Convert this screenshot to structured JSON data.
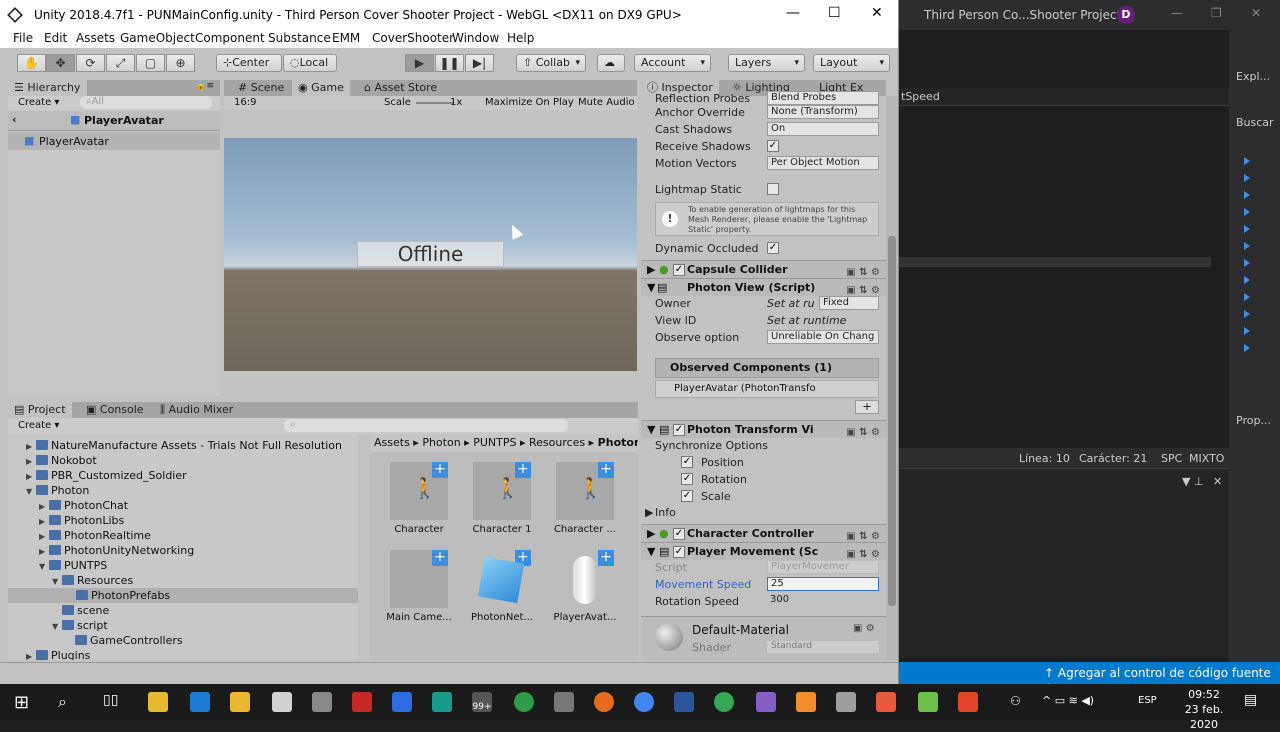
{
  "unity": {
    "title": "Unity 2018.4.7f1 - PUNMainConfig.unity - Third Person Cover Shooter Project - WebGL <DX11 on DX9 GPU>",
    "menu": [
      "File",
      "Edit",
      "Assets",
      "GameObject",
      "Component",
      "Substance",
      "EMM",
      "CoverShooter",
      "Window",
      "Help"
    ],
    "toolbar": {
      "center": "Center",
      "local": "Local",
      "collab": "Collab",
      "account": "Account",
      "layers": "Layers",
      "layout": "Layout"
    },
    "hierarchy": {
      "tab": "Hierarchy",
      "create": "Create",
      "search": "All",
      "prefab": "PlayerAvatar",
      "row": "PlayerAvatar"
    },
    "scene_tabs": {
      "scene": "Scene",
      "game": "Game",
      "asset_store": "Asset Store"
    },
    "game": {
      "aspect": "16:9",
      "scale_label": "Scale",
      "scale_value": "1x",
      "maximize": "Maximize On Play",
      "mute": "Mute Audio",
      "offline": "Offline"
    },
    "project": {
      "tabs": {
        "project": "Project",
        "console": "Console",
        "audio": "Audio Mixer"
      },
      "create": "Create",
      "tree": [
        "NatureManufacture Assets - Trials Not Full Resolution",
        "Nokobot",
        "PBR_Customized_Soldier",
        "Photon",
        "PhotonChat",
        "PhotonLibs",
        "PhotonRealtime",
        "PhotonUnityNetworking",
        "PUNTPS",
        "Resources",
        "PhotonPrefabs",
        "scene",
        "script",
        "GameControllers",
        "Plugins"
      ],
      "breadcrumb": [
        "Assets",
        "Photon",
        "PUNTPS",
        "Resources",
        "PhotonPrefabs"
      ],
      "assets": [
        "Character",
        "Character 1",
        "Character ...",
        "Main Came...",
        "PhotonNet...",
        "PlayerAvat..."
      ]
    },
    "inspector": {
      "tabs": {
        "inspector": "Inspector",
        "lighting": "Lighting",
        "light": "Light Ex"
      },
      "rows": [
        {
          "k": "Reflection Probes",
          "v": "Blend Probes"
        },
        {
          "k": "Anchor Override",
          "v": "None (Transform)"
        },
        {
          "k": "Cast Shadows",
          "v": "On"
        },
        {
          "k": "Receive Shadows",
          "v": "✓"
        },
        {
          "k": "Motion Vectors",
          "v": "Per Object Motion"
        },
        {
          "k": "Lightmap Static",
          "v": ""
        }
      ],
      "help": "To enable generation of lightmaps for this Mesh Renderer, please enable the 'Lightmap Static' property.",
      "dynamic_occluded": "Dynamic Occluded",
      "capsule": "Capsule Collider",
      "photon_view": "Photon View (Script)",
      "pv_rows": [
        {
          "k": "Owner",
          "v": "Set at ru"
        },
        {
          "k": "View ID",
          "v": "Set at runtime"
        },
        {
          "k": "Observe option",
          "v": "Unreliable On Chang"
        }
      ],
      "owner_fixed": "Fixed",
      "observed": "Observed Components (1)",
      "observed_item": "PlayerAvatar (PhotonTransfo",
      "ptv": "Photon Transform Vi",
      "sync": "Synchronize Options",
      "sync_opts": [
        "Position",
        "Rotation",
        "Scale"
      ],
      "info": "Info",
      "cc": "Character Controller",
      "pm": "Player Movement (Sc",
      "pm_rows": [
        {
          "k": "Script",
          "v": "PlayerMovemer"
        },
        {
          "k": "Movement Speed",
          "v": "25"
        },
        {
          "k": "Rotation Speed",
          "v": "300"
        }
      ],
      "material": "Default-Material",
      "shader_label": "Shader",
      "shader": "Standard"
    }
  },
  "vs": {
    "title": "Third Person Co...Shooter Project",
    "avatar": "D",
    "strip": "tSpeed",
    "explorer": "Expl...",
    "search": "Buscar",
    "props": "Prop...",
    "status": {
      "line": "Línea: 10",
      "char": "Carácter: 21",
      "spc": "SPC",
      "mode": "MIXTO"
    },
    "source_control": "Agregar al control de código fuente"
  },
  "taskbar": {
    "time": "09:52",
    "date": "23 feb. 2020",
    "lang": "ESP",
    "badge": "99+"
  }
}
